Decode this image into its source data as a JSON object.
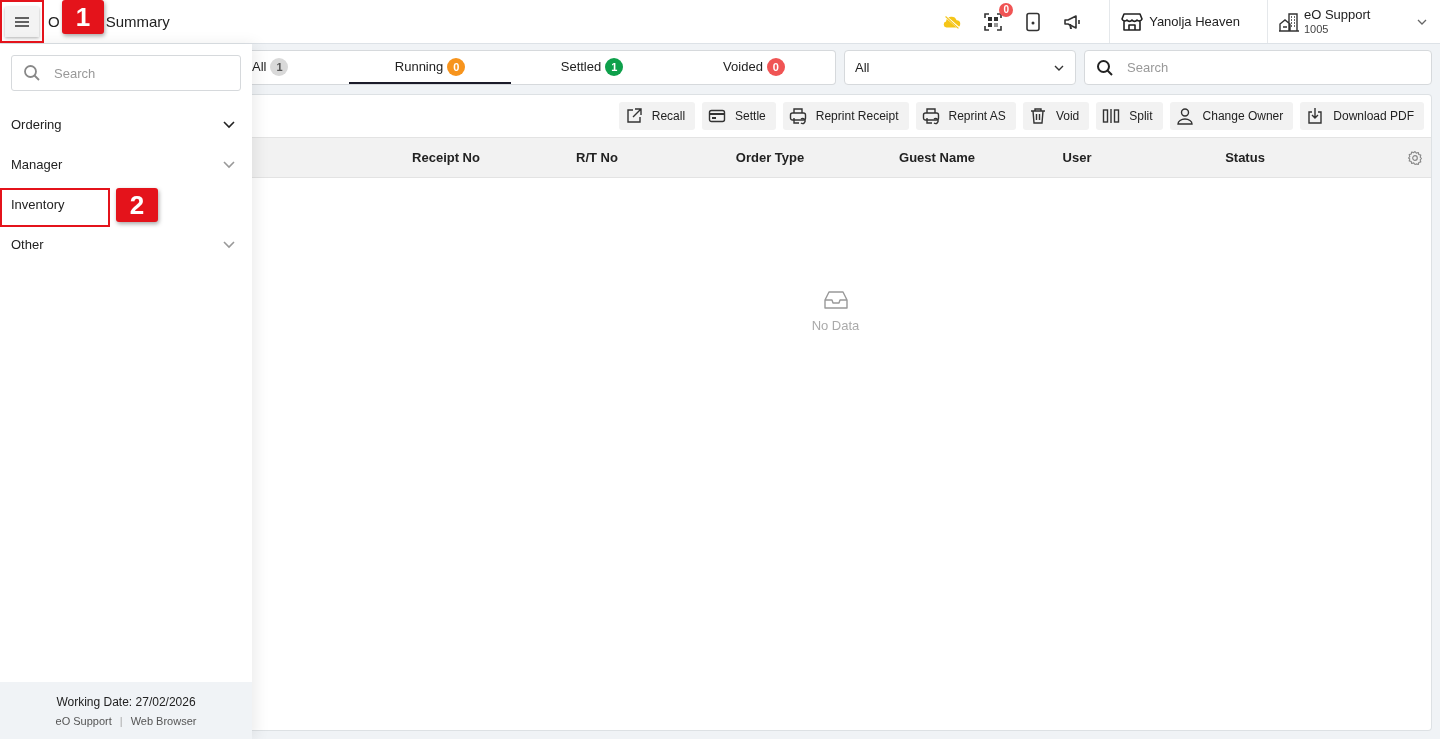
{
  "header": {
    "title_start": "O",
    "title_end": "Summary",
    "qr_badge": "0",
    "store": "Yanolja Heaven",
    "user": {
      "name": "eO Support",
      "code": "1005"
    }
  },
  "annotations": [
    {
      "label": "1"
    },
    {
      "label": "2"
    }
  ],
  "sidebar": {
    "search": {
      "placeholder": "Search"
    },
    "items": [
      {
        "label": "Ordering",
        "expandable": true
      },
      {
        "label": "Manager",
        "expandable": true
      },
      {
        "label": "Inventory",
        "expandable": false
      },
      {
        "label": "Other",
        "expandable": true
      }
    ],
    "footer": {
      "working_date": "Working Date: 27/02/2026",
      "user": "eO Support",
      "separator": "|",
      "device": "Web Browser"
    }
  },
  "tabs": [
    {
      "label": "All",
      "count": "1",
      "color": "#d9d9d9",
      "selected": false
    },
    {
      "label": "Running",
      "count": "0",
      "color": "#f7941d",
      "selected": true
    },
    {
      "label": "Settled",
      "count": "1",
      "color": "#0ea04b",
      "selected": false
    },
    {
      "label": "Voided",
      "count": "0",
      "color": "#f05454",
      "selected": false
    }
  ],
  "filter": {
    "value": "All"
  },
  "search": {
    "placeholder": "Search"
  },
  "toolbar": [
    {
      "label": "Recall",
      "kind": "recall"
    },
    {
      "label": "Settle",
      "kind": "settle"
    },
    {
      "label": "Reprint Receipt",
      "kind": "reprint"
    },
    {
      "label": "Reprint AS",
      "kind": "reprint"
    },
    {
      "label": "Void",
      "kind": "void"
    },
    {
      "label": "Split",
      "kind": "split"
    },
    {
      "label": "Change Owner",
      "kind": "owner"
    },
    {
      "label": "Download PDF",
      "kind": "download"
    }
  ],
  "table": {
    "columns": [
      "Receipt No",
      "R/T No",
      "Order Type",
      "Guest Name",
      "User",
      "Status"
    ],
    "empty_text": "No Data"
  }
}
